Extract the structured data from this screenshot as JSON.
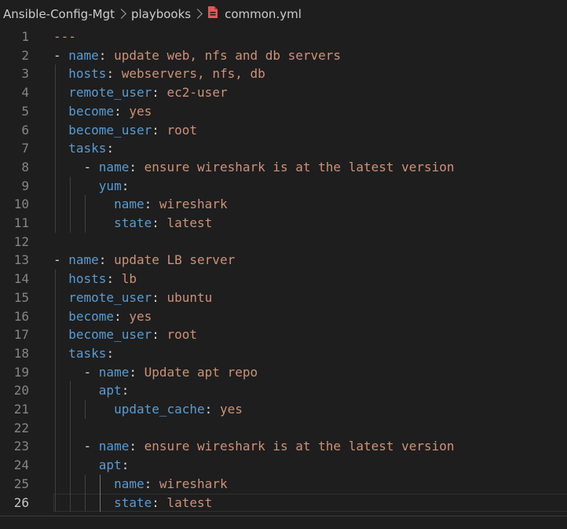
{
  "breadcrumb": {
    "items": [
      "Ansible-Config-Mgt",
      "playbooks",
      "common.yml"
    ],
    "file_icon": "yaml-file-icon",
    "file_icon_color": "#e8545a"
  },
  "editor": {
    "current_line": 26,
    "colors": {
      "key": "#569cd6",
      "value": "#ce9178",
      "punctuation": "#d4d4d4",
      "line_number": "#858585",
      "background": "#1e1e1e"
    },
    "lines": [
      {
        "n": "1",
        "indent": "",
        "dash": false,
        "key": "",
        "value": "---"
      },
      {
        "n": "2",
        "indent": "",
        "dash": true,
        "key": "name",
        "value": "update web, nfs and db servers"
      },
      {
        "n": "3",
        "indent": "  ",
        "dash": false,
        "key": "hosts",
        "value": "webservers, nfs, db"
      },
      {
        "n": "4",
        "indent": "  ",
        "dash": false,
        "key": "remote_user",
        "value": "ec2-user"
      },
      {
        "n": "5",
        "indent": "  ",
        "dash": false,
        "key": "become",
        "value": "yes"
      },
      {
        "n": "6",
        "indent": "  ",
        "dash": false,
        "key": "become_user",
        "value": "root"
      },
      {
        "n": "7",
        "indent": "  ",
        "dash": false,
        "key": "tasks",
        "value": ""
      },
      {
        "n": "8",
        "indent": "    ",
        "dash": true,
        "key": "name",
        "value": "ensure wireshark is at the latest version"
      },
      {
        "n": "9",
        "indent": "      ",
        "dash": false,
        "key": "yum",
        "value": ""
      },
      {
        "n": "10",
        "indent": "        ",
        "dash": false,
        "key": "name",
        "value": "wireshark"
      },
      {
        "n": "11",
        "indent": "        ",
        "dash": false,
        "key": "state",
        "value": "latest"
      },
      {
        "n": "12",
        "indent": "",
        "dash": false,
        "key": "",
        "value": ""
      },
      {
        "n": "13",
        "indent": "",
        "dash": true,
        "key": "name",
        "value": "update LB server"
      },
      {
        "n": "14",
        "indent": "  ",
        "dash": false,
        "key": "hosts",
        "value": "lb"
      },
      {
        "n": "15",
        "indent": "  ",
        "dash": false,
        "key": "remote_user",
        "value": "ubuntu"
      },
      {
        "n": "16",
        "indent": "  ",
        "dash": false,
        "key": "become",
        "value": "yes"
      },
      {
        "n": "17",
        "indent": "  ",
        "dash": false,
        "key": "become_user",
        "value": "root"
      },
      {
        "n": "18",
        "indent": "  ",
        "dash": false,
        "key": "tasks",
        "value": ""
      },
      {
        "n": "19",
        "indent": "    ",
        "dash": true,
        "key": "name",
        "value": "Update apt repo"
      },
      {
        "n": "20",
        "indent": "      ",
        "dash": false,
        "key": "apt",
        "value": ""
      },
      {
        "n": "21",
        "indent": "        ",
        "dash": false,
        "key": "update_cache",
        "value": "yes"
      },
      {
        "n": "22",
        "indent": "",
        "dash": false,
        "key": "",
        "value": ""
      },
      {
        "n": "23",
        "indent": "    ",
        "dash": true,
        "key": "name",
        "value": "ensure wireshark is at the latest version"
      },
      {
        "n": "24",
        "indent": "      ",
        "dash": false,
        "key": "apt",
        "value": ""
      },
      {
        "n": "25",
        "indent": "        ",
        "dash": false,
        "key": "name",
        "value": "wireshark"
      },
      {
        "n": "26",
        "indent": "        ",
        "dash": false,
        "key": "state",
        "value": "latest"
      }
    ]
  }
}
